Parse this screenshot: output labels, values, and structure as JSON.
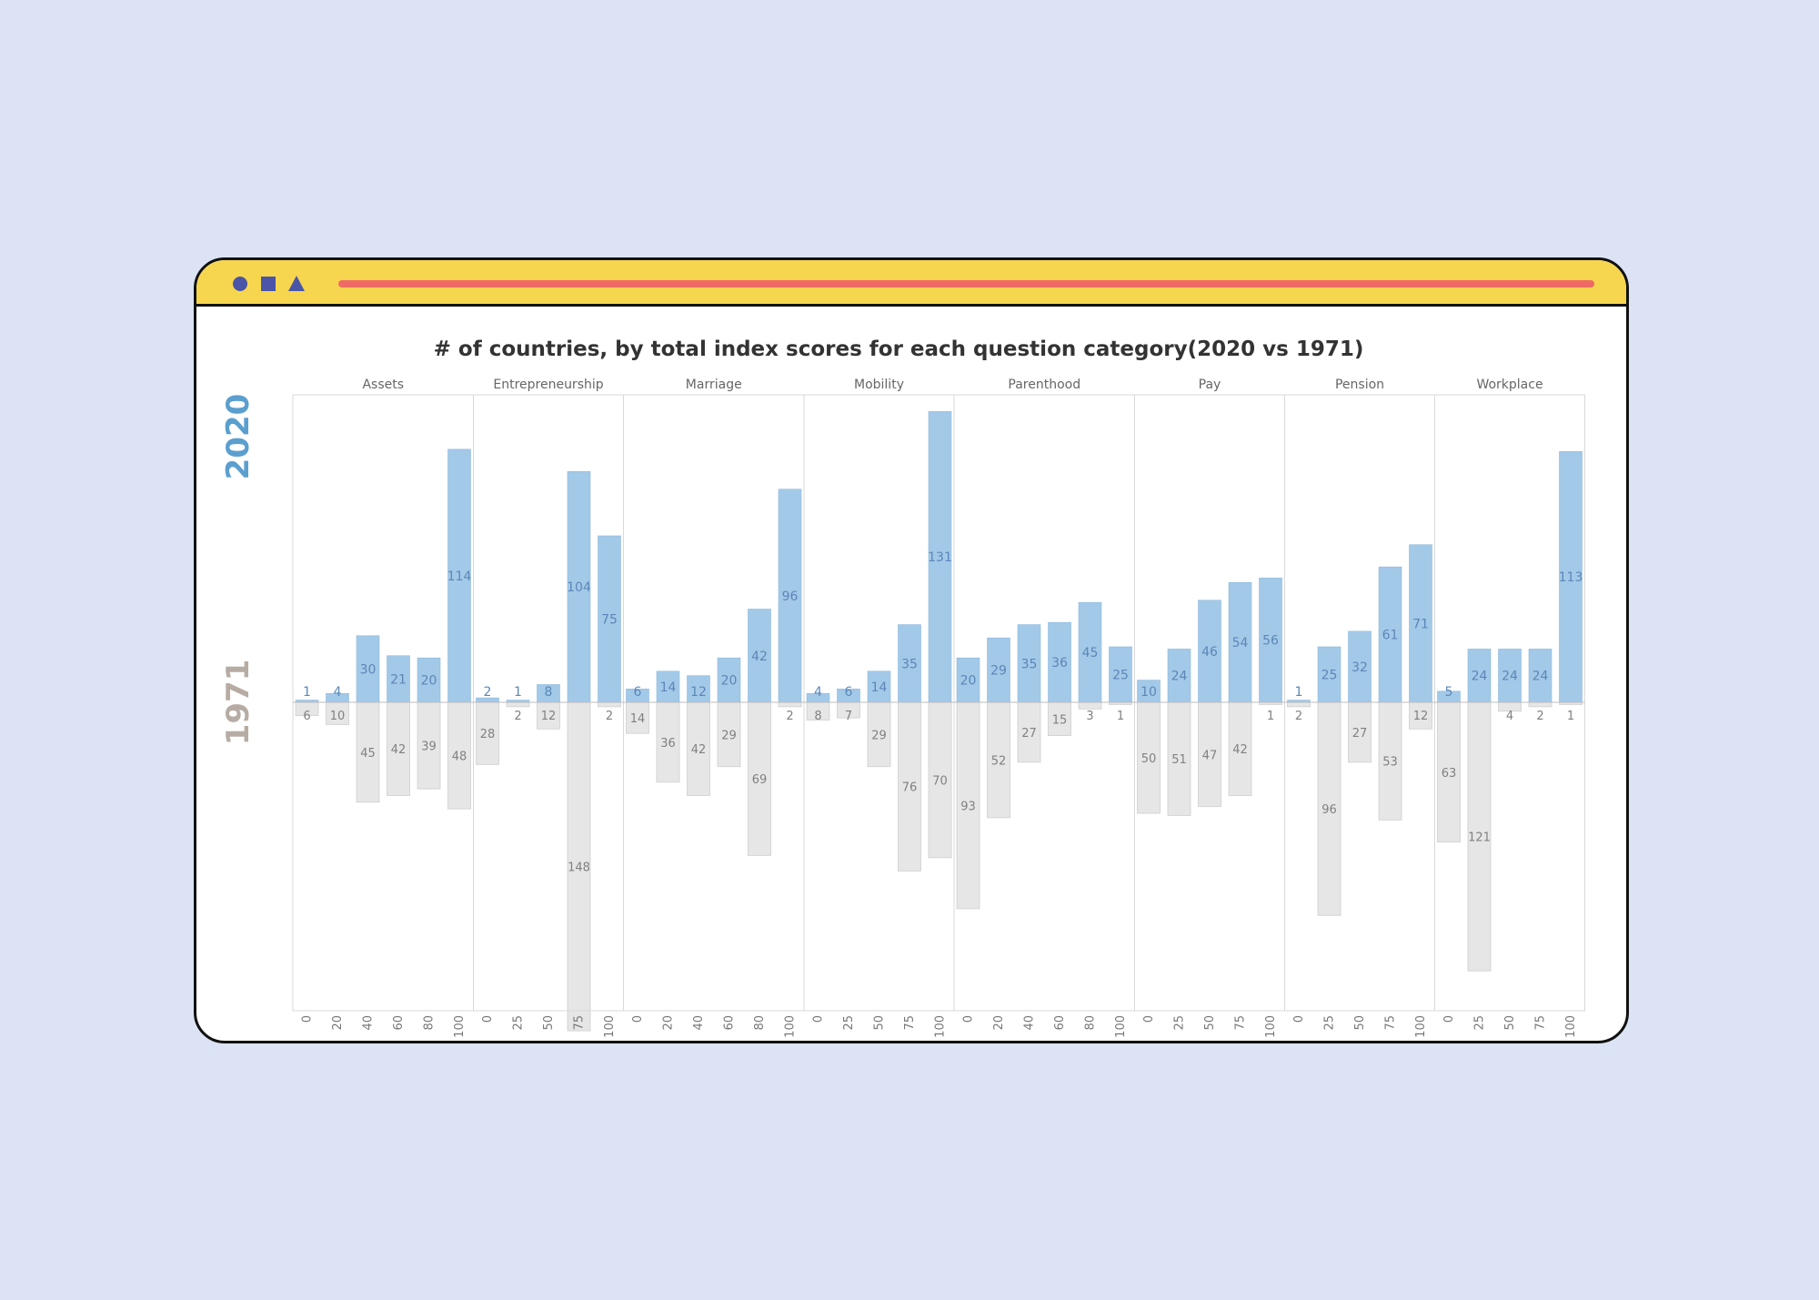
{
  "window": {
    "icons": [
      "circle-icon",
      "square-icon",
      "triangle-icon"
    ],
    "accent_color": "#f7d64f",
    "bar_color": "#ef6a64"
  },
  "chart_data": {
    "type": "bar",
    "title": "# of countries, by total index scores for each question category(2020 vs 1971)",
    "row_labels": [
      "2020",
      "1971"
    ],
    "colors": {
      "2020": "#a3c9e8",
      "1971": "#e6e6e6"
    },
    "panels": [
      {
        "category": "Assets",
        "ticks": [
          "0",
          "20",
          "40",
          "60",
          "80",
          "100"
        ],
        "v2020": [
          1,
          4,
          30,
          21,
          20,
          114
        ],
        "v1971": [
          6,
          10,
          45,
          42,
          39,
          48
        ]
      },
      {
        "category": "Entrepreneurship",
        "ticks": [
          "0",
          "25",
          "50",
          "75",
          "100"
        ],
        "v2020": [
          2,
          1,
          8,
          104,
          75
        ],
        "v1971": [
          28,
          2,
          12,
          148,
          2
        ]
      },
      {
        "category": "Marriage",
        "ticks": [
          "0",
          "20",
          "40",
          "60",
          "80",
          "100"
        ],
        "v2020": [
          6,
          14,
          12,
          20,
          42,
          96
        ],
        "v1971": [
          14,
          36,
          42,
          29,
          69,
          2
        ]
      },
      {
        "category": "Mobility",
        "ticks": [
          "0",
          "25",
          "50",
          "75",
          "100"
        ],
        "v2020": [
          4,
          6,
          14,
          35,
          131
        ],
        "v1971": [
          8,
          7,
          29,
          76,
          70
        ]
      },
      {
        "category": "Parenthood",
        "ticks": [
          "0",
          "20",
          "40",
          "60",
          "80",
          "100"
        ],
        "v2020": [
          20,
          29,
          35,
          36,
          45,
          25
        ],
        "v1971": [
          93,
          52,
          27,
          15,
          3,
          1
        ]
      },
      {
        "category": "Pay",
        "ticks": [
          "0",
          "25",
          "50",
          "75",
          "100"
        ],
        "v2020": [
          10,
          24,
          46,
          54,
          56
        ],
        "v1971": [
          50,
          51,
          47,
          42,
          1
        ]
      },
      {
        "category": "Pension",
        "ticks": [
          "0",
          "25",
          "50",
          "75",
          "100"
        ],
        "v2020": [
          1,
          25,
          32,
          61,
          71
        ],
        "v1971": [
          2,
          96,
          27,
          53,
          12
        ]
      },
      {
        "category": "Workplace",
        "ticks": [
          "0",
          "25",
          "50",
          "75",
          "100"
        ],
        "v2020": [
          5,
          24,
          24,
          24,
          113
        ],
        "v1971": [
          63,
          121,
          4,
          2,
          1
        ]
      }
    ]
  }
}
